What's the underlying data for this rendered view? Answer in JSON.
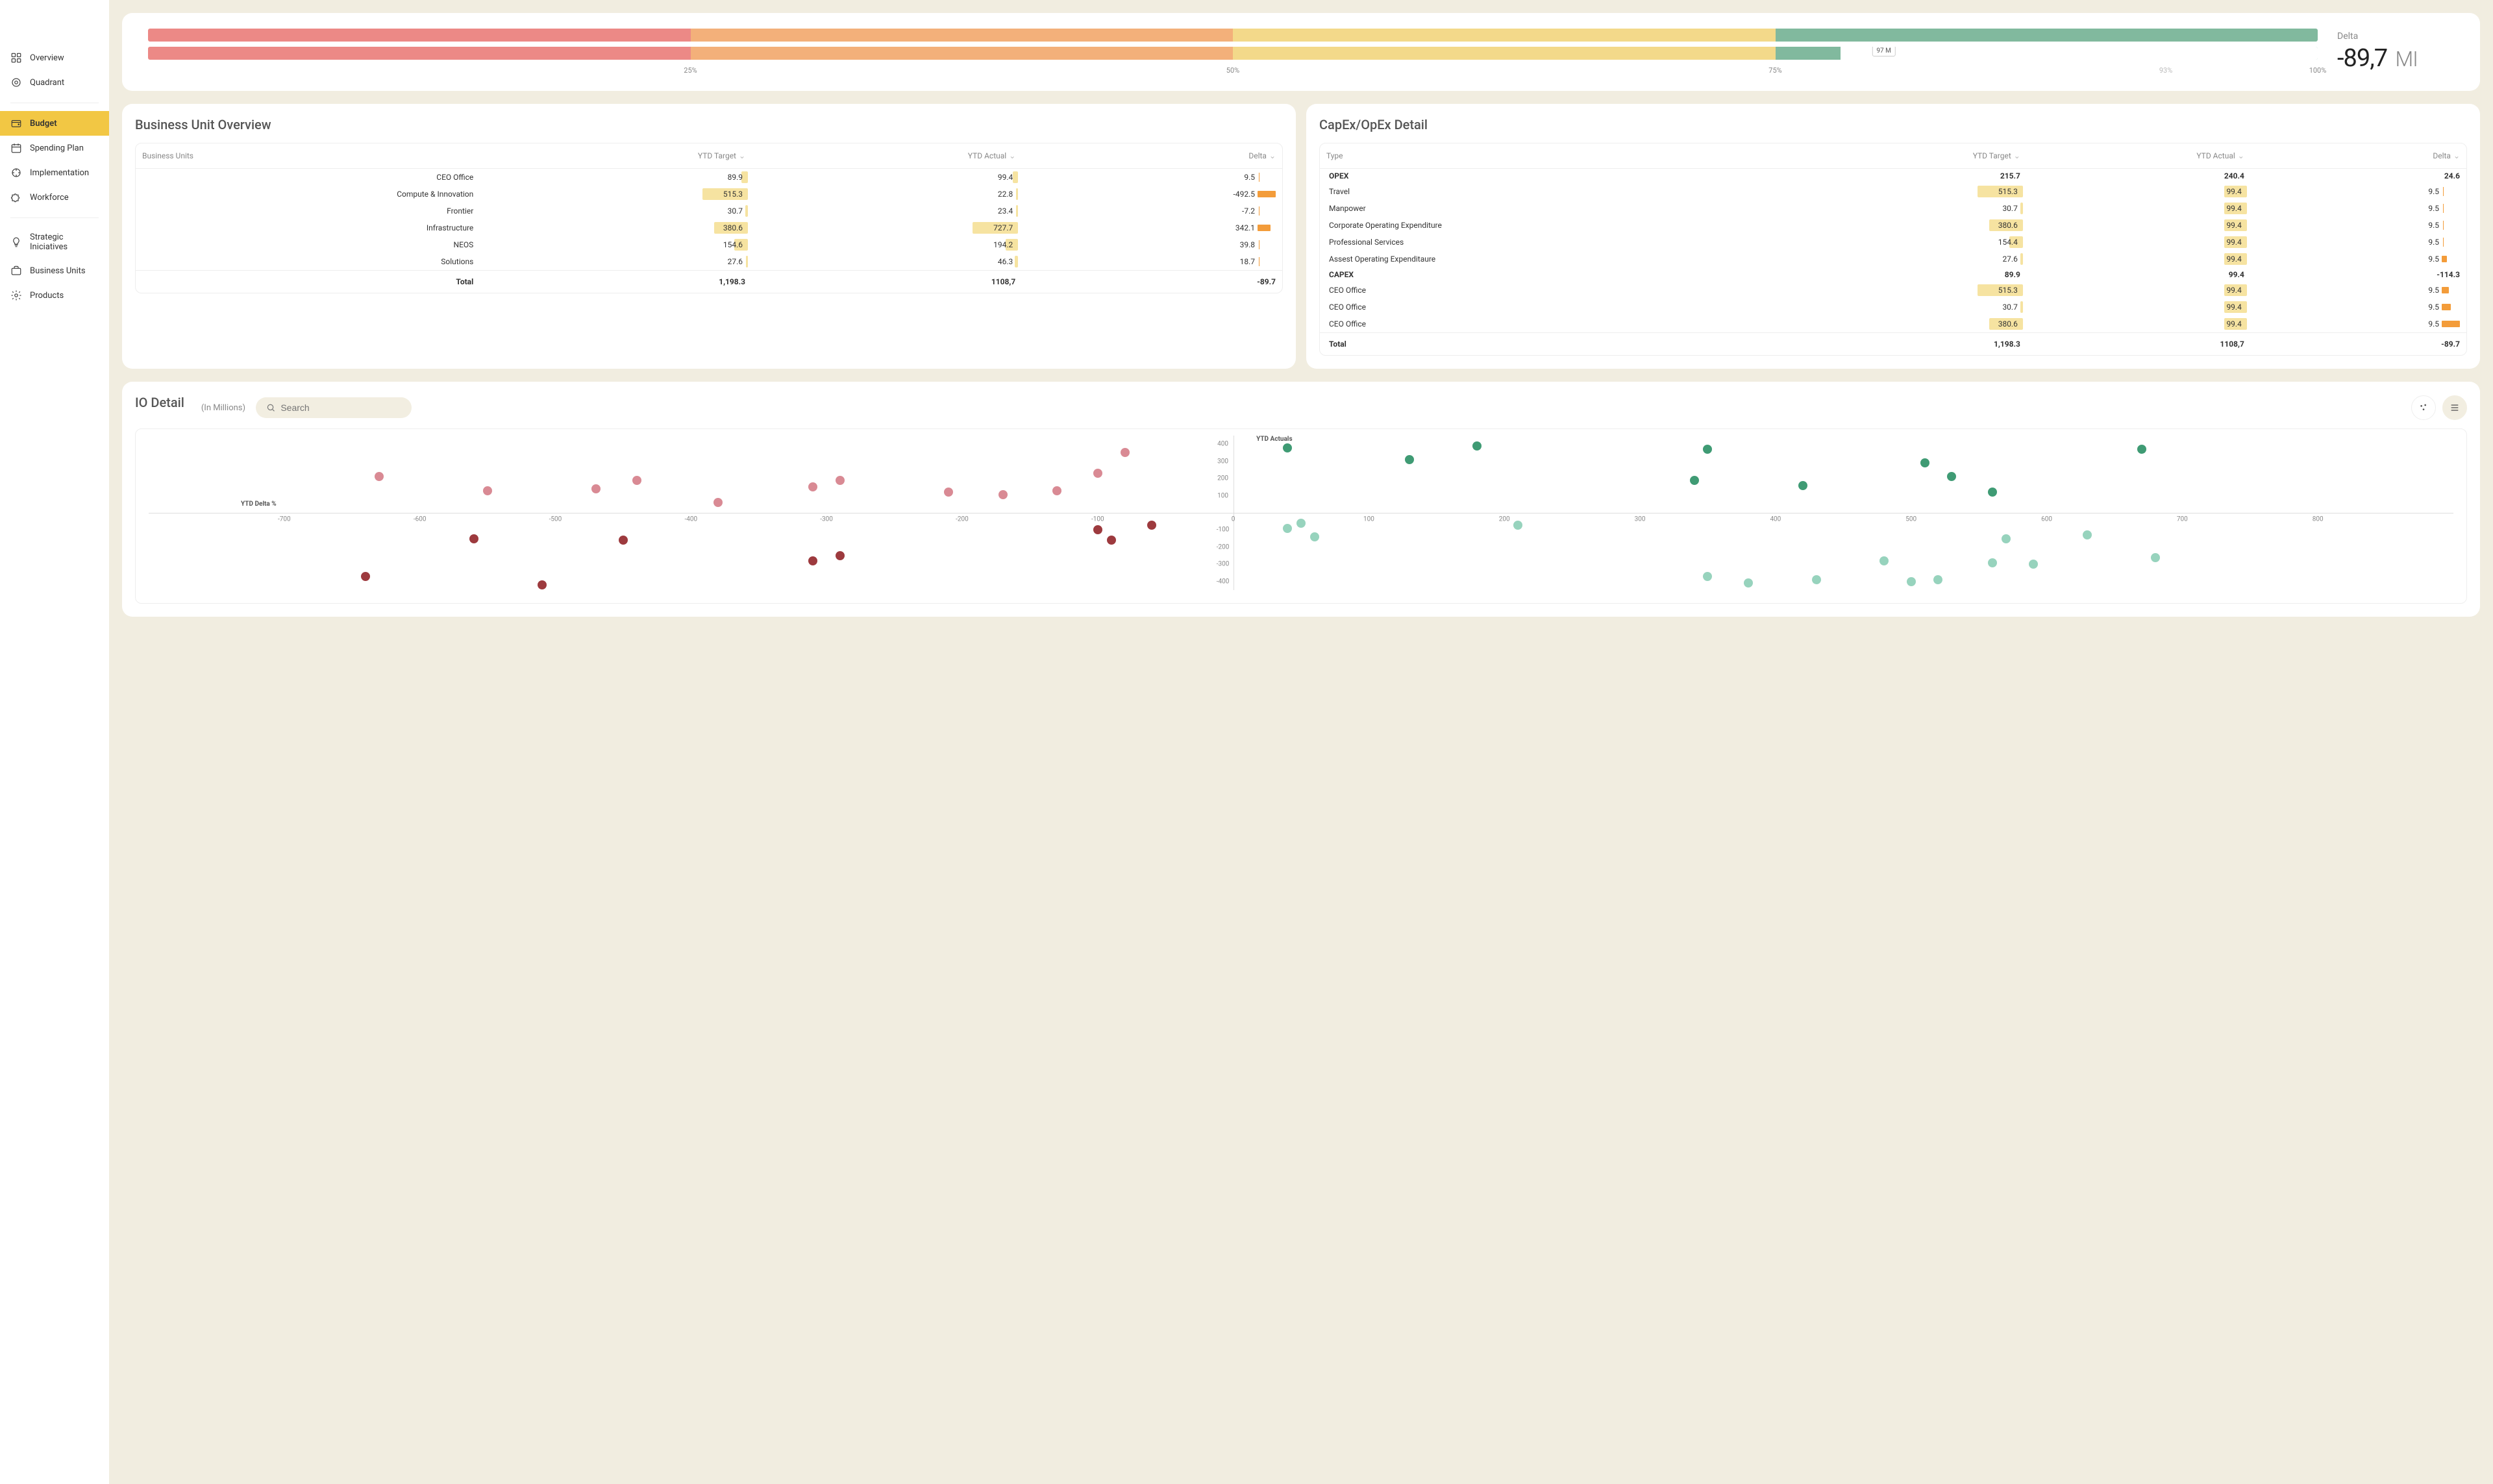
{
  "sidebar": {
    "groups": [
      [
        {
          "key": "overview",
          "label": "Overview",
          "icon": "grid"
        },
        {
          "key": "quadrant",
          "label": "Quadrant",
          "icon": "target"
        }
      ],
      [
        {
          "key": "budget",
          "label": "Budget",
          "icon": "wallet",
          "active": true
        },
        {
          "key": "spending-plan",
          "label": "Spending Plan",
          "icon": "calendar"
        },
        {
          "key": "implementation",
          "label": "Implementation",
          "icon": "target-arrow"
        },
        {
          "key": "workforce",
          "label": "Workforce",
          "icon": "puzzle"
        }
      ],
      [
        {
          "key": "strategic",
          "label": "Strategic Iniciatives",
          "icon": "bulb"
        },
        {
          "key": "business-units",
          "label": "Business Units",
          "icon": "briefcase"
        },
        {
          "key": "products",
          "label": "Products",
          "icon": "gear"
        }
      ]
    ]
  },
  "gauge": {
    "value_pct": 78,
    "marker_pct": 80,
    "marker_label": "97 M",
    "extra_tick": {
      "pct": 93,
      "label": "93%"
    },
    "ticks": [
      {
        "pct": 25,
        "label": "25%"
      },
      {
        "pct": 50,
        "label": "50%"
      },
      {
        "pct": 75,
        "label": "75%"
      },
      {
        "pct": 100,
        "label": "100%"
      }
    ],
    "delta_label": "Delta",
    "delta_value": "-89,7",
    "delta_unit": "MI"
  },
  "bu": {
    "title": "Business Unit Overview",
    "cols": [
      "Business Units",
      "YTD Target",
      "YTD Actual",
      "Delta"
    ],
    "rows": [
      {
        "name": "CEO Office",
        "target": 89.9,
        "actual": 99.4,
        "delta": 9.5,
        "tb": 0.15,
        "ab": 0.12,
        "db": 0.05
      },
      {
        "name": "Compute & Innovation",
        "target": 515.3,
        "actual": 22.8,
        "delta": -492.5,
        "tb": 1.0,
        "ab": 0.05,
        "db": 1.0
      },
      {
        "name": "Frontier",
        "target": 30.7,
        "actual": 23.4,
        "delta": -7.2,
        "tb": 0.06,
        "ab": 0.05,
        "db": 0.04
      },
      {
        "name": "Infrastructure",
        "target": 380.6,
        "actual": 727.7,
        "delta": 342.1,
        "tb": 0.74,
        "ab": 1.0,
        "db": 0.7
      },
      {
        "name": "NEOS",
        "target": 154.6,
        "actual": 194.2,
        "delta": 39.8,
        "tb": 0.3,
        "ab": 0.27,
        "db": 0.1
      },
      {
        "name": "Solutions",
        "target": 27.6,
        "actual": 46.3,
        "delta": 18.7,
        "tb": 0.05,
        "ab": 0.07,
        "db": 0.06
      }
    ],
    "total": {
      "label": "Total",
      "target": "1,198.3",
      "actual": "1108,7",
      "delta": "-89.7"
    }
  },
  "capex": {
    "title": "CapEx/OpEx Detail",
    "cols": [
      "Type",
      "YTD Target",
      "YTD Actual",
      "Delta"
    ],
    "rows": [
      {
        "name": "OPEX",
        "bold": true,
        "target": 215.7,
        "actual": 240.4,
        "delta": 24.6,
        "plain": true
      },
      {
        "name": "Travel",
        "target": 515.3,
        "actual": 99.4,
        "delta": 9.5,
        "tb": 1.0,
        "ab": 0.5,
        "db": 0.1
      },
      {
        "name": "Manpower",
        "target": 30.7,
        "actual": 99.4,
        "delta": 9.5,
        "tb": 0.06,
        "ab": 0.5,
        "db": 0.1
      },
      {
        "name": "Corporate Operating Expenditure",
        "target": 380.6,
        "actual": 99.4,
        "delta": 9.5,
        "tb": 0.74,
        "ab": 0.5,
        "db": 0.1
      },
      {
        "name": "Professional Services",
        "target": 154.4,
        "actual": 99.4,
        "delta": 9.5,
        "tb": 0.3,
        "ab": 0.5,
        "db": 0.1
      },
      {
        "name": "Assest Operating Expenditaure",
        "target": 27.6,
        "actual": 99.4,
        "delta": 9.5,
        "tb": 0.05,
        "ab": 0.5,
        "db": 0.3,
        "orange": true
      },
      {
        "name": "CAPEX",
        "bold": true,
        "target": 89.9,
        "actual": 99.4,
        "delta": -114.3,
        "plain": true
      },
      {
        "name": "CEO Office",
        "target": 515.3,
        "actual": 99.4,
        "delta": 9.5,
        "tb": 1.0,
        "ab": 0.5,
        "db": 0.4,
        "orange": true
      },
      {
        "name": "CEO Office",
        "target": 30.7,
        "actual": 99.4,
        "delta": 9.5,
        "tb": 0.06,
        "ab": 0.5,
        "db": 0.5,
        "orange": true
      },
      {
        "name": "CEO Office",
        "target": 380.6,
        "actual": 99.4,
        "delta": 9.5,
        "tb": 0.74,
        "ab": 0.5,
        "db": 1.0,
        "orange": true
      }
    ],
    "total": {
      "label": "Total",
      "target": "1,198.3",
      "actual": "1108,7",
      "delta": "-89.7"
    }
  },
  "io": {
    "title": "IO Detail",
    "subtitle": "(In Millions)",
    "search_placeholder": "Search",
    "y_label": "YTD Actuals",
    "x_label": "YTD Delta %"
  },
  "chart_data": {
    "type": "scatter",
    "x_range": [
      -800,
      900
    ],
    "y_range": [
      -450,
      450
    ],
    "x_ticks": [
      -700,
      -600,
      -500,
      -400,
      -300,
      -200,
      -100,
      0,
      100,
      200,
      300,
      400,
      500,
      600,
      700,
      800
    ],
    "y_ticks": [
      -400,
      -300,
      -200,
      -100,
      0,
      100,
      200,
      300,
      400
    ],
    "xlabel": "YTD Delta %",
    "ylabel": "YTD Actuals",
    "series": [
      {
        "name": "neg-high",
        "color": "#d98a94",
        "points": [
          [
            -630,
            210
          ],
          [
            -550,
            130
          ],
          [
            -470,
            140
          ],
          [
            -440,
            190
          ],
          [
            -380,
            60
          ],
          [
            -310,
            150
          ],
          [
            -290,
            190
          ],
          [
            -210,
            120
          ],
          [
            -170,
            105
          ],
          [
            -130,
            130
          ],
          [
            -100,
            230
          ],
          [
            -80,
            350
          ]
        ]
      },
      {
        "name": "neg-low",
        "color": "#9d3a3e",
        "points": [
          [
            -640,
            -370
          ],
          [
            -560,
            -150
          ],
          [
            -510,
            -420
          ],
          [
            -450,
            -160
          ],
          [
            -310,
            -280
          ],
          [
            -290,
            -250
          ],
          [
            -100,
            -100
          ],
          [
            -90,
            -160
          ],
          [
            -60,
            -70
          ]
        ]
      },
      {
        "name": "pos-high",
        "color": "#3f9b74",
        "points": [
          [
            40,
            380
          ],
          [
            130,
            310
          ],
          [
            180,
            390
          ],
          [
            350,
            370
          ],
          [
            340,
            190
          ],
          [
            420,
            160
          ],
          [
            510,
            290
          ],
          [
            530,
            210
          ],
          [
            560,
            120
          ],
          [
            670,
            370
          ]
        ]
      },
      {
        "name": "pos-low",
        "color": "#97d3bd",
        "points": [
          [
            40,
            -90
          ],
          [
            50,
            -60
          ],
          [
            60,
            -140
          ],
          [
            210,
            -70
          ],
          [
            350,
            -370
          ],
          [
            380,
            -410
          ],
          [
            430,
            -390
          ],
          [
            480,
            -280
          ],
          [
            500,
            -400
          ],
          [
            520,
            -390
          ],
          [
            560,
            -290
          ],
          [
            570,
            -150
          ],
          [
            590,
            -300
          ],
          [
            630,
            -130
          ],
          [
            680,
            -260
          ]
        ]
      }
    ]
  }
}
